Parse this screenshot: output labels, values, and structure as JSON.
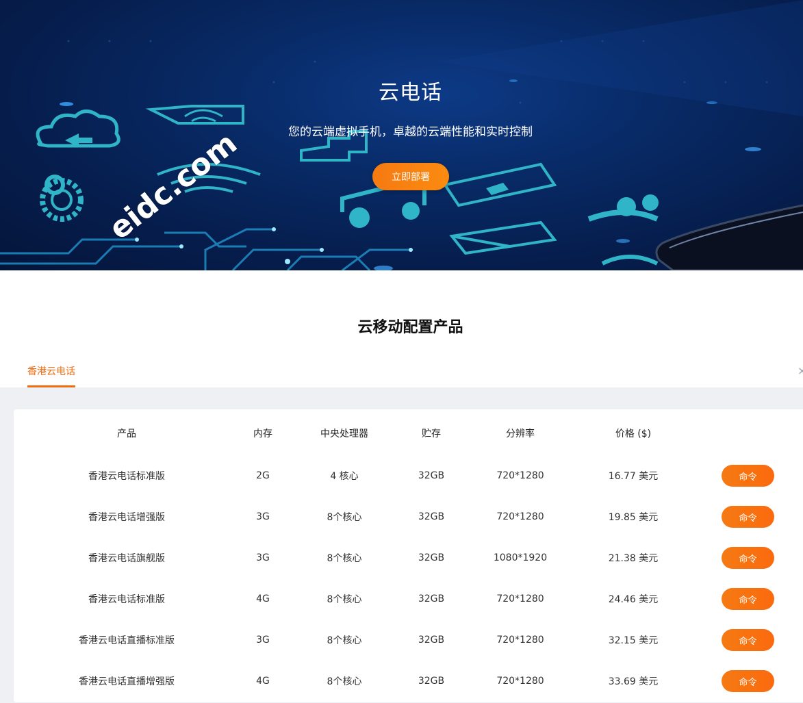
{
  "hero": {
    "title": "云电话",
    "subtitle": "您的云端虚拟手机，卓越的云端性能和实时控制",
    "cta_label": "立即部署",
    "watermark": "eidc.com"
  },
  "section": {
    "title": "云移动配置产品",
    "tabs": [
      {
        "label": "香港云电话"
      }
    ],
    "close_glyph": "×"
  },
  "table": {
    "headers": [
      "产品",
      "内存",
      "中央处理器",
      "贮存",
      "分辨率",
      "价格 ($)"
    ],
    "rows": [
      {
        "product": "香港云电话标准版",
        "memory": "2G",
        "cpu": "4 核心",
        "storage": "32GB",
        "resolution": "720*1280",
        "price": "16.77 美元",
        "action": "命令"
      },
      {
        "product": "香港云电话增强版",
        "memory": "3G",
        "cpu": "8个核心",
        "storage": "32GB",
        "resolution": "720*1280",
        "price": "19.85 美元",
        "action": "命令"
      },
      {
        "product": "香港云电话旗舰版",
        "memory": "3G",
        "cpu": "8个核心",
        "storage": "32GB",
        "resolution": "1080*1920",
        "price": "21.38 美元",
        "action": "命令"
      },
      {
        "product": "香港云电话标准版",
        "memory": "4G",
        "cpu": "8个核心",
        "storage": "32GB",
        "resolution": "720*1280",
        "price": "24.46 美元",
        "action": "命令"
      },
      {
        "product": "香港云电话直播标准版",
        "memory": "3G",
        "cpu": "8个核心",
        "storage": "32GB",
        "resolution": "720*1280",
        "price": "32.15 美元",
        "action": "命令"
      },
      {
        "product": "香港云电话直播增强版",
        "memory": "4G",
        "cpu": "8个核心",
        "storage": "32GB",
        "resolution": "720*1280",
        "price": "33.69 美元",
        "action": "命令"
      }
    ]
  },
  "colors": {
    "accent": "#f57a12",
    "hero_bg": "#082a66",
    "panel_bg": "#eef0f4"
  }
}
